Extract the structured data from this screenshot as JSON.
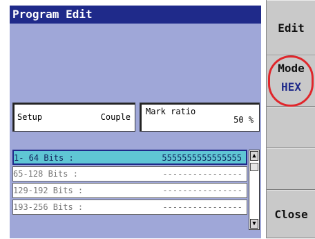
{
  "title": "Program Edit",
  "setup": {
    "label": "Setup",
    "value": "Couple"
  },
  "mark_ratio": {
    "label": "Mark ratio",
    "value": "50 %"
  },
  "bit_rows": [
    {
      "range": " 1- 64 Bits :",
      "bits": "5555555555555555",
      "selected": true
    },
    {
      "range": " 65-128 Bits :",
      "bits": "----------------",
      "selected": false
    },
    {
      "range": "129-192 Bits :",
      "bits": "----------------",
      "selected": false
    },
    {
      "range": "193-256 Bits :",
      "bits": "----------------",
      "selected": false
    }
  ],
  "scrollbar": {
    "up_icon": "triangle-up",
    "down_icon": "triangle-down"
  },
  "softkeys": {
    "edit": "Edit",
    "mode_label": "Mode",
    "mode_value": "HEX",
    "close": "Close"
  },
  "colors": {
    "title_bg": "#1f2a8a",
    "panel_bg": "#9fa7d8",
    "selected_row": "#5fc6d4",
    "softkey_bg": "#c9c9c9",
    "highlight_circle": "#e0262b"
  }
}
